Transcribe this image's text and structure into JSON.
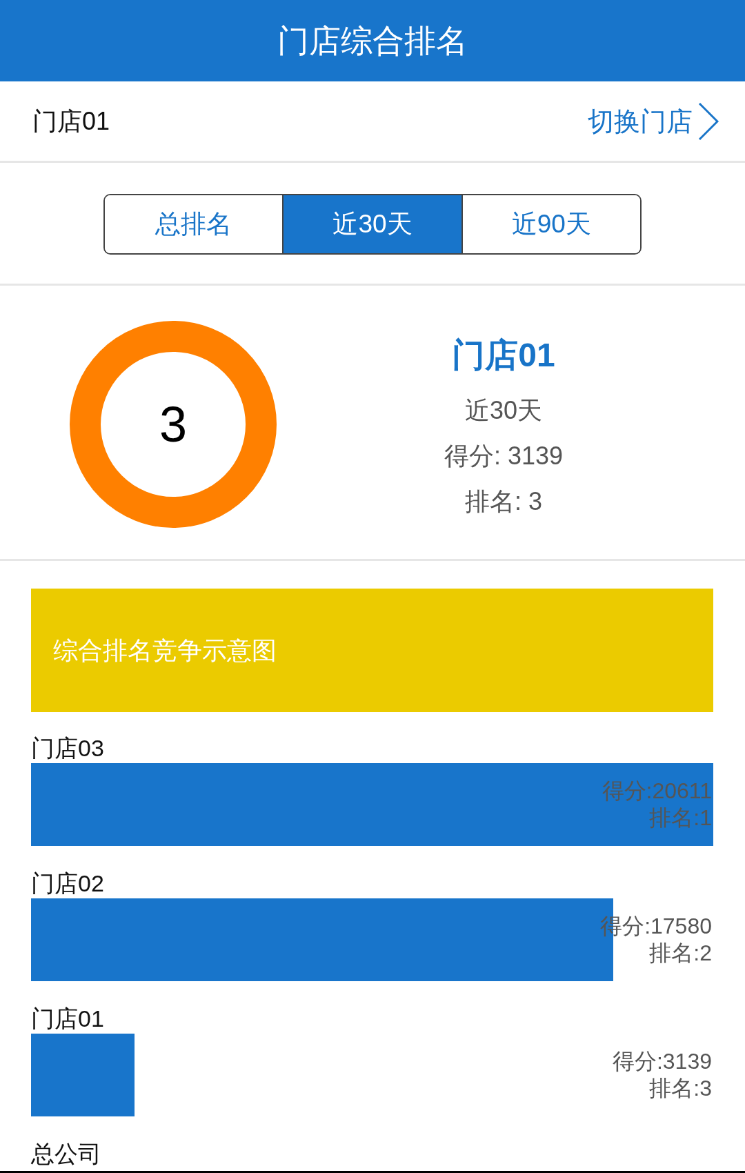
{
  "header": {
    "title": "门店综合排名"
  },
  "store_bar": {
    "store_name": "门店01",
    "switch_link": "切换门店"
  },
  "tabs": [
    {
      "label": "总排名",
      "selected": false
    },
    {
      "label": "近30天",
      "selected": true
    },
    {
      "label": "近90天",
      "selected": false
    }
  ],
  "summary": {
    "rank_number": "3",
    "store_name": "门店01",
    "period": "近30天",
    "score": "得分: 3139",
    "rank": "排名: 3"
  },
  "chart_banner": {
    "title": "综合排名竞争示意图"
  },
  "ranking": [
    {
      "store": "门店03",
      "level": 1,
      "score": "得分:20611",
      "rank": "排名:1"
    },
    {
      "store": "门店02",
      "level": 0.853,
      "score": "得分:17580",
      "rank": "排名:2"
    },
    {
      "store": "门店01",
      "level": 0.152,
      "score": "得分:3139",
      "rank": "排名:3"
    },
    {
      "store": "总公司"
    }
  ]
}
